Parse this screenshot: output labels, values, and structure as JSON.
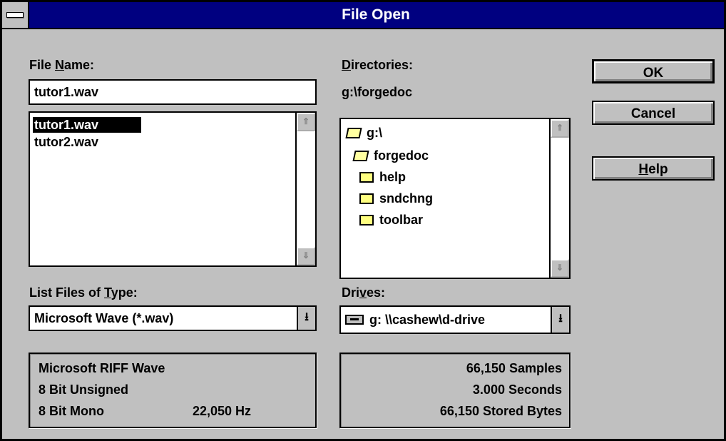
{
  "window": {
    "title": "File Open"
  },
  "file_name": {
    "label": "File Name:",
    "value": "tutor1.wav",
    "files": [
      "tutor1.wav",
      "tutor2.wav"
    ],
    "selected_index": 0
  },
  "directories": {
    "label": "Directories:",
    "current_path": "g:\\forgedoc",
    "tree": [
      {
        "name": "g:\\",
        "icon": "open-folder-icon"
      },
      {
        "name": "forgedoc",
        "icon": "open-folder-icon"
      },
      {
        "name": "help",
        "icon": "folder-icon"
      },
      {
        "name": "sndchng",
        "icon": "folder-icon"
      },
      {
        "name": "toolbar",
        "icon": "folder-icon"
      }
    ]
  },
  "file_type": {
    "label": "List Files of Type:",
    "selected": "Microsoft Wave (*.wav)"
  },
  "drives": {
    "label": "Drives:",
    "selected": "g: \\\\cashew\\d-drive"
  },
  "buttons": {
    "ok": "OK",
    "cancel": "Cancel",
    "help": "Help"
  },
  "format_info": {
    "line1": "Microsoft RIFF Wave",
    "line2": "8 Bit Unsigned",
    "line3_left": "8 Bit Mono",
    "line3_right": "22,050 Hz"
  },
  "sample_info": {
    "samples": "66,150 Samples",
    "seconds": "3.000 Seconds",
    "stored_bytes": "66,150 Stored Bytes"
  },
  "colors": {
    "titlebar": "#000080",
    "face": "#c0c0c0",
    "selection": "#000000"
  }
}
